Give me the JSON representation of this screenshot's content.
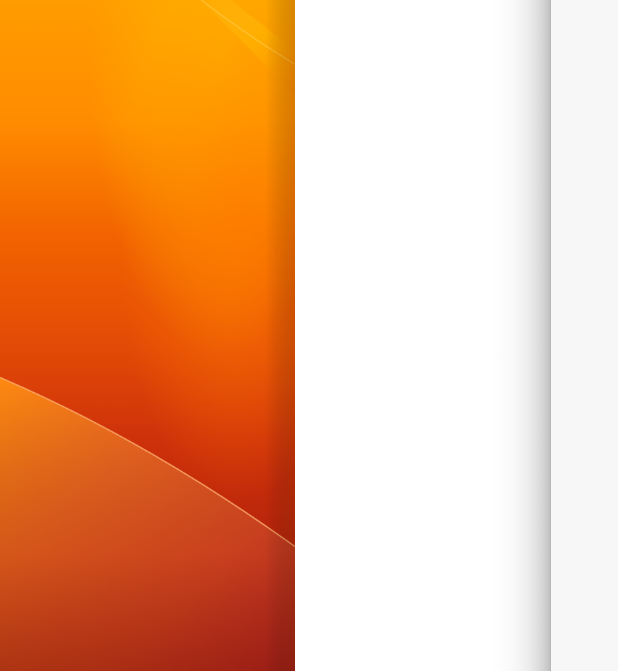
{
  "colors": {
    "wallpaper_top": "#ffa800",
    "wallpaper_mid": "#f25a00",
    "wallpaper_bottom": "#b8200a",
    "window_background": "#ffffff",
    "side_panel_background": "#f7f7f7",
    "window_edge": "#b8b8b8"
  },
  "icons": {
    "wallpaper": "desktop-wallpaper-image"
  }
}
